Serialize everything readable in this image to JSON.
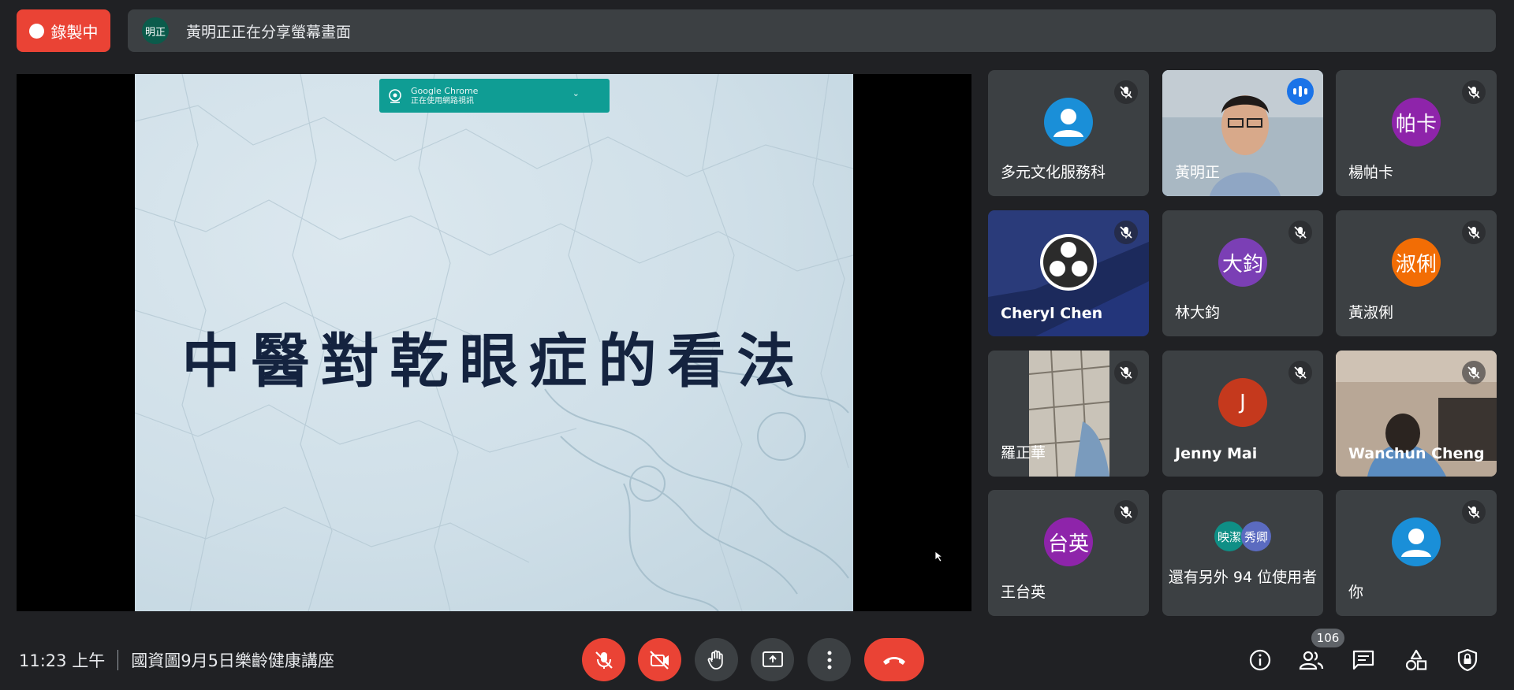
{
  "recording": {
    "label": "錄製中"
  },
  "share_banner": {
    "avatar_initials": "明正",
    "text": "黃明正正在分享螢幕畫面"
  },
  "chrome_notice": {
    "app": "Google Chrome",
    "message": "正在使用網路視訊"
  },
  "slide": {
    "title": "中醫對乾眼症的看法"
  },
  "participants": [
    {
      "name": "多元文化服務科",
      "avatar": "person-icon",
      "avatar_color": "#1a8fd8",
      "muted": true
    },
    {
      "name": "黃明正",
      "video": true,
      "speaking": true,
      "muted": false
    },
    {
      "name": "楊帕卡",
      "initials": "帕卡",
      "avatar_color": "#8e24aa",
      "muted": true
    },
    {
      "name": "Cheryl Chen",
      "avatar": "obs-logo",
      "muted": true
    },
    {
      "name": "林大鈞",
      "initials": "大鈞",
      "avatar_color": "#7b3fb5",
      "muted": true
    },
    {
      "name": "黃淑俐",
      "initials": "淑俐",
      "avatar_color": "#f26d05",
      "muted": true
    },
    {
      "name": "羅正華",
      "video": true,
      "muted": true
    },
    {
      "name": "Jenny Mai",
      "initials": "J",
      "avatar_color": "#c5391d",
      "muted": true
    },
    {
      "name": "Wanchun Cheng",
      "video": true,
      "muted": true
    },
    {
      "name": "王台英",
      "initials": "台英",
      "avatar_color": "#8e24aa",
      "muted": true
    },
    {
      "others_label": "還有另外 94 位使用者",
      "avatars": [
        "映潔",
        "秀卿"
      ],
      "avatar_colors": [
        "#0f8f86",
        "#5b6bc0"
      ]
    },
    {
      "name": "你",
      "avatar": "person-icon",
      "avatar_color": "#1a8fd8",
      "muted": true
    }
  ],
  "footer": {
    "time": "11:23 上午",
    "meeting_title": "國資圖9月5日樂齡健康講座",
    "participant_count": "106"
  },
  "colors": {
    "accent_red": "#ea4335",
    "background": "#202124",
    "tile": "#3c4043",
    "active_outline": "#8ab4f8"
  }
}
